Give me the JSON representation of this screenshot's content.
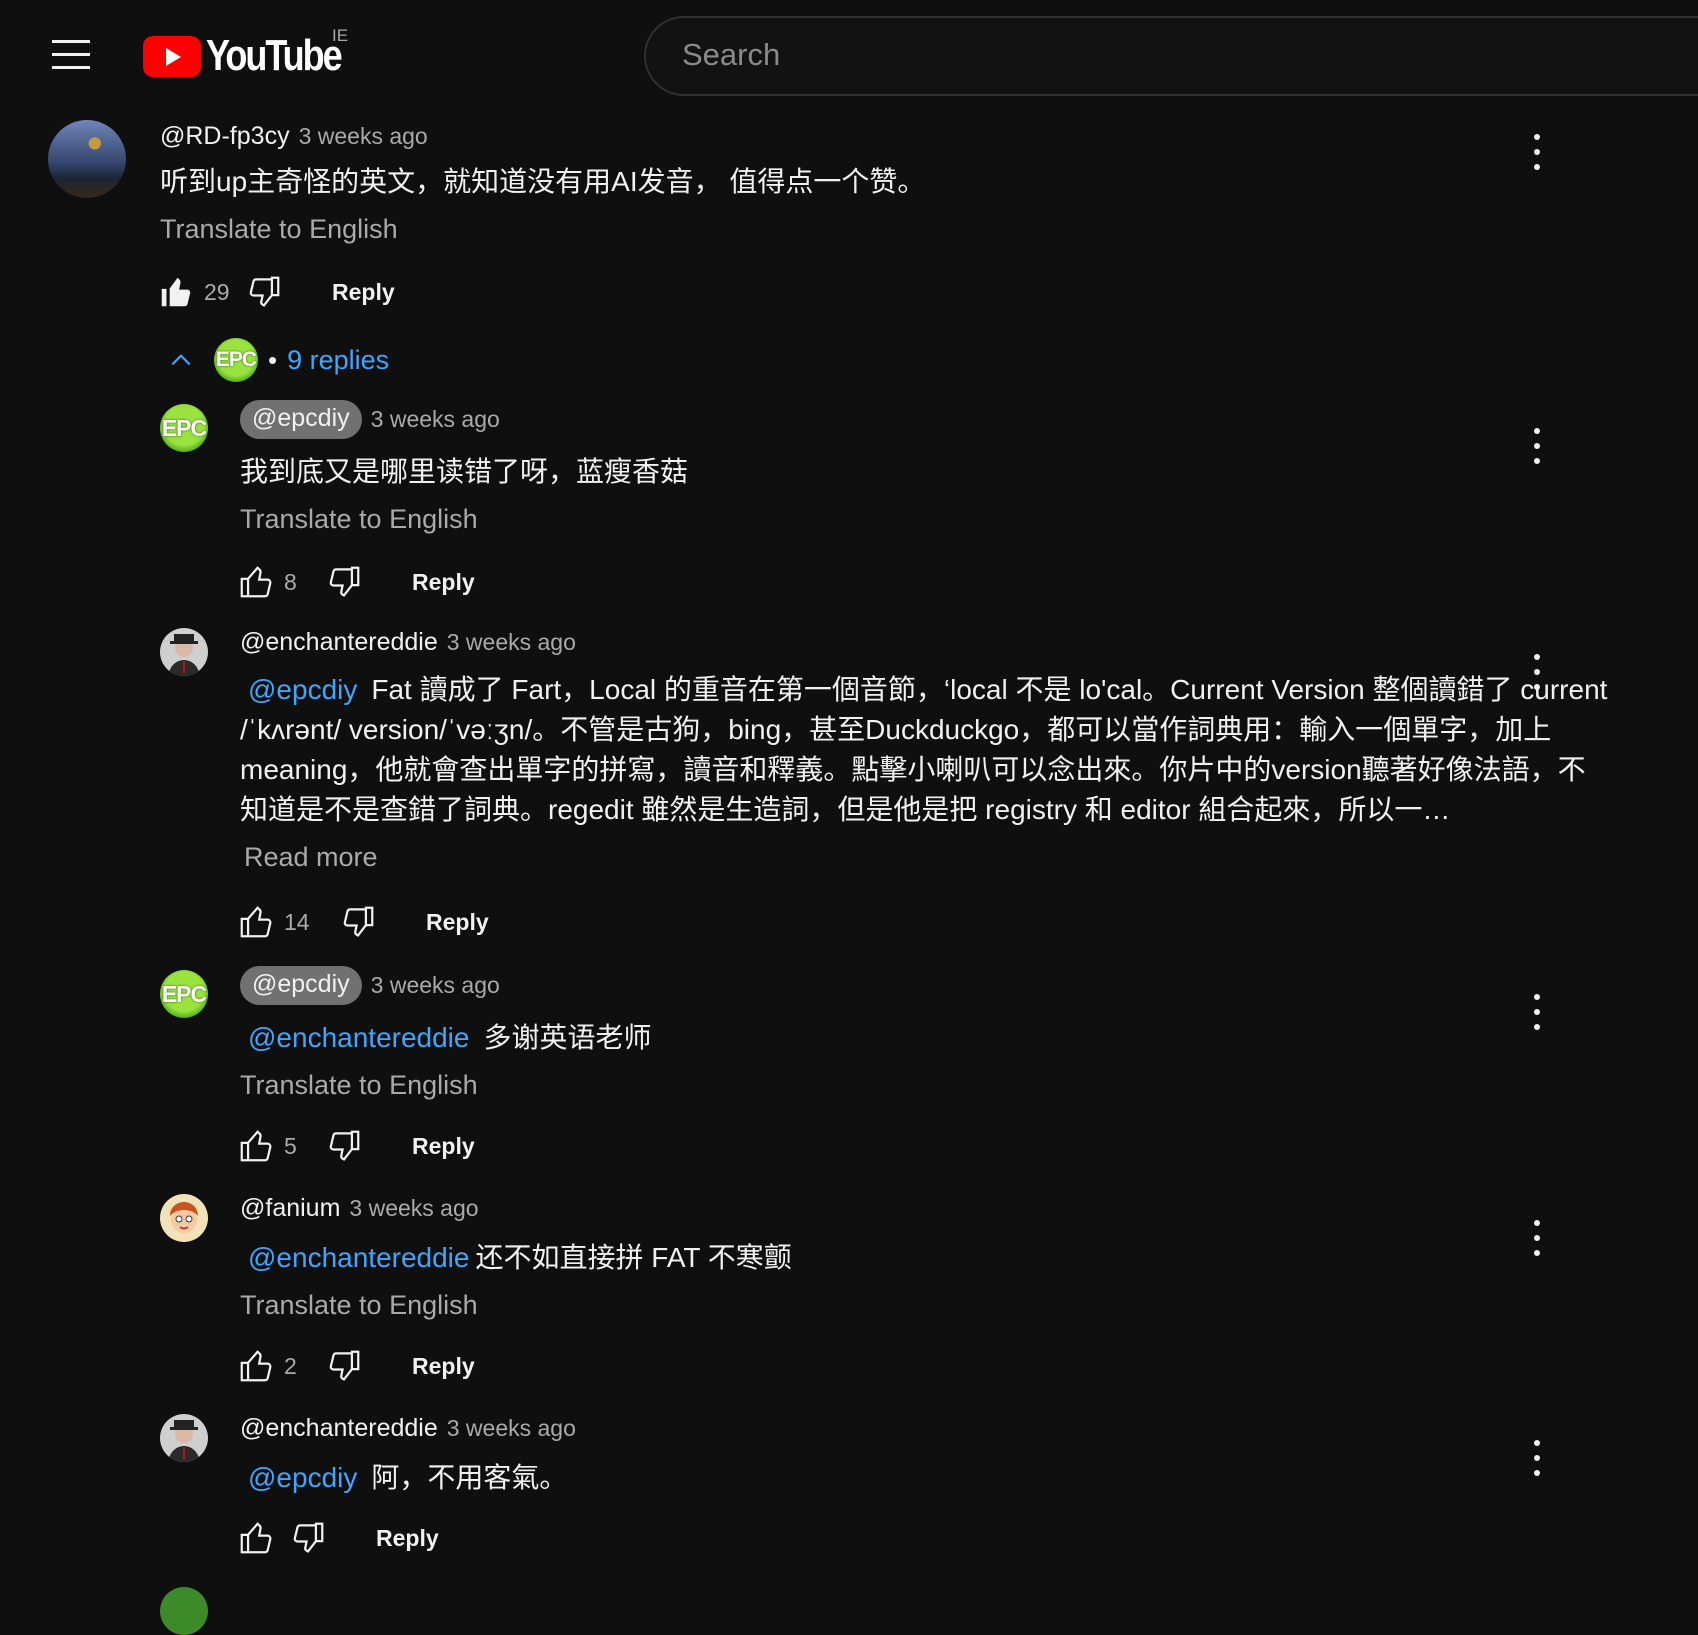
{
  "header": {
    "logo_text": "YouTube",
    "country_code": "IE",
    "search_placeholder": "Search"
  },
  "colors": {
    "accent_link": "#3ea6ff",
    "logo_red": "#ff0000",
    "background": "#0f0f0f"
  },
  "main_comment": {
    "handle": "@RD-fp3cy",
    "time": "3 weeks ago",
    "text": "听到up主奇怪的英文，就知道没有用AI发音， 值得点一个赞。",
    "translate": "Translate to English",
    "likes": "29",
    "reply": "Reply",
    "replies_count_label": "9 replies",
    "replies_avatar_text": "EPC"
  },
  "replies": [
    {
      "handle": "@epcdiy",
      "is_creator": true,
      "time": "3 weeks ago",
      "mention": "",
      "text": "我到底又是哪里读错了呀，蓝瘦香菇",
      "translate": "Translate to English",
      "likes": "8",
      "reply": "Reply",
      "avatar": "EPC"
    },
    {
      "handle": "@enchantereddie",
      "is_creator": false,
      "time": "3 weeks ago",
      "mention": "@epcdiy",
      "text": "Fat 讀成了 Fart，Local 的重音在第一個音節，‘local 不是 lo'cal。Current Version 整個讀錯了 current /ˈkʌrənt/ version/ˈvəːʒn/。不管是古狗，bing，甚至Duckduckgo，都可以當作詞典用：輸入一個單字，加上meaning，他就會查出單字的拼寫，讀音和釋義。點擊小喇叭可以念出來。你片中的version聽著好像法語，不知道是不是查錯了詞典。regedit 雖然是生造詞，但是他是把 registry 和 editor 組合起來，所以一…",
      "read_more": "Read more",
      "likes": "14",
      "reply": "Reply"
    },
    {
      "handle": "@epcdiy",
      "is_creator": true,
      "time": "3 weeks ago",
      "mention": "@enchantereddie",
      "text": "多谢英语老师",
      "translate": "Translate to English",
      "likes": "5",
      "reply": "Reply",
      "avatar": "EPC"
    },
    {
      "handle": "@fanium",
      "is_creator": false,
      "time": "3 weeks ago",
      "mention": "@enchantereddie",
      "text": "还不如直接拼 FAT  不寒颤",
      "translate": "Translate to English",
      "likes": "2",
      "reply": "Reply"
    },
    {
      "handle": "@enchantereddie",
      "is_creator": false,
      "time": "3 weeks ago",
      "mention": "@epcdiy",
      "text": "阿，不用客氣。",
      "likes": "",
      "reply": "Reply"
    }
  ]
}
